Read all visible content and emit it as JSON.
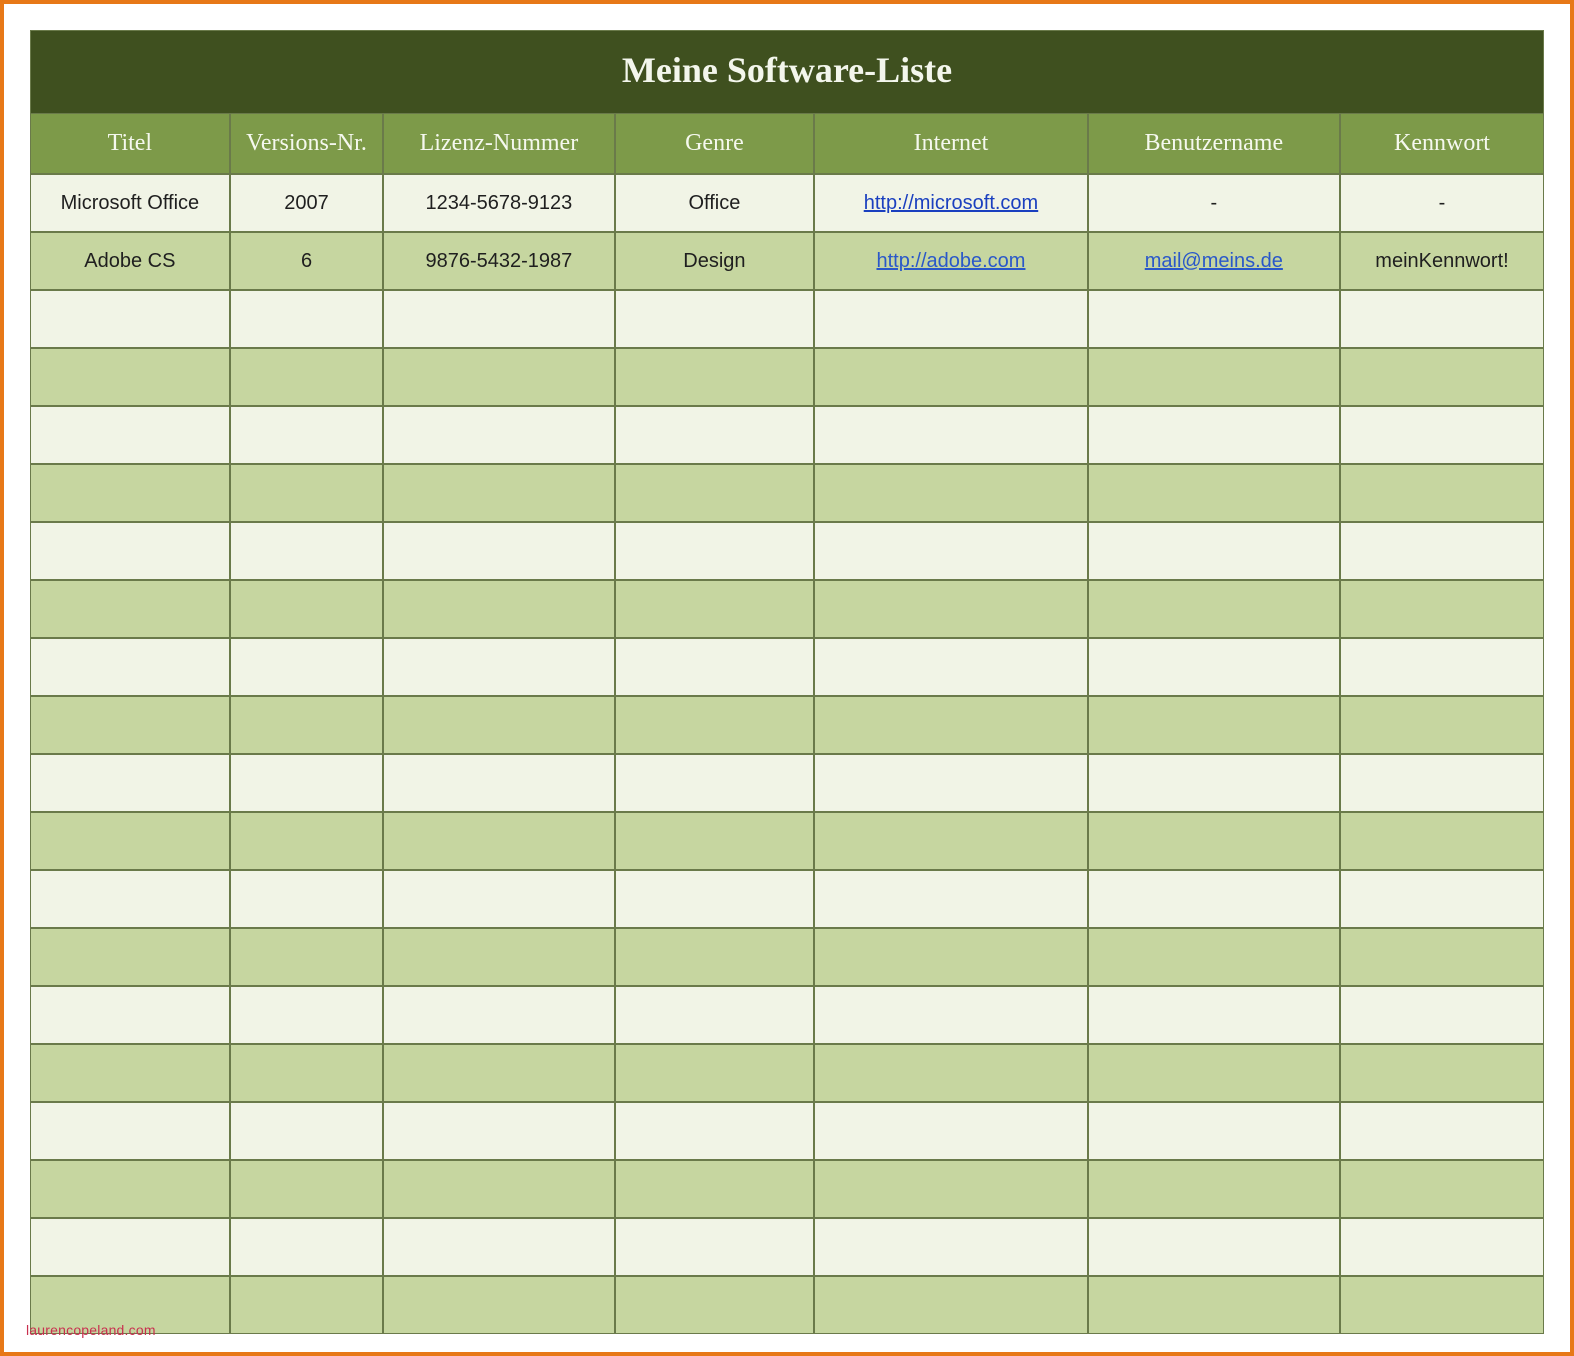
{
  "title": "Meine Software-Liste",
  "watermark": "laurencopeland.com",
  "columns": [
    "Titel",
    "Versions-Nr.",
    "Lizenz-Nummer",
    "Genre",
    "Internet",
    "Benutzername",
    "Kennwort"
  ],
  "rows": [
    {
      "titel": "Microsoft Office",
      "version": "2007",
      "lizenz": "1234-5678-9123",
      "genre": "Office",
      "internet": "http://microsoft.com",
      "internet_is_link": true,
      "benutzername": "-",
      "benutzername_is_link": false,
      "kennwort": "-"
    },
    {
      "titel": "Adobe CS",
      "version": "6",
      "lizenz": "9876-5432-1987",
      "genre": "Design",
      "internet": "http://adobe.com",
      "internet_is_link": true,
      "benutzername": "mail@meins.de",
      "benutzername_is_link": true,
      "kennwort": "meinKennwort!"
    }
  ],
  "empty_row_count": 18
}
